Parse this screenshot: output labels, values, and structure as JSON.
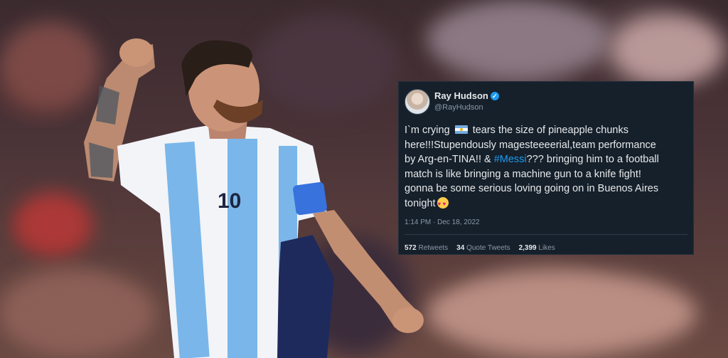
{
  "photo": {
    "jersey_number": "10",
    "subject": "Argentina player celebrating"
  },
  "tweet": {
    "name": "Ray Hudson",
    "handle": "@RayHudson",
    "body_1": "I`m crying ",
    "body_2": " tears the size of pineapple chunks here!!!Stupendously magesteeeerial,team performance by Arg-en-TINA!! & ",
    "hashtag": "#Messi",
    "body_3": "??? bringing him to a football match is like bringing a machine gun to a knife fight! gonna be some serious loving going on in Buenos Aires tonight",
    "timestamp": "1:14 PM · Dec 18, 2022",
    "retweets_count": "572",
    "retweets_label": "Retweets",
    "quotes_count": "34",
    "quotes_label": "Quote Tweets",
    "likes_count": "2,399",
    "likes_label": "Likes",
    "icons": [
      "verified-icon",
      "argentina-flag-icon",
      "smiling-face-with-hearts-icon"
    ]
  }
}
